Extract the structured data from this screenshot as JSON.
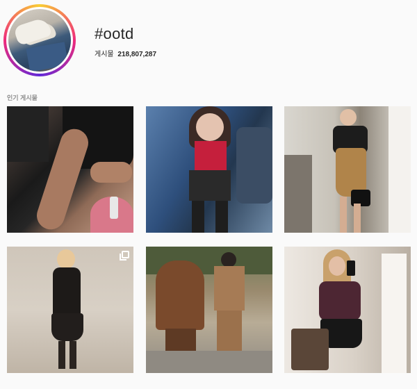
{
  "header": {
    "hashtag": "#ootd",
    "posts_label": "게시물",
    "posts_count": "218,807,287"
  },
  "top_posts": {
    "section_label": "인기 게시물",
    "posts": [
      {
        "kind": "single"
      },
      {
        "kind": "single"
      },
      {
        "kind": "single"
      },
      {
        "kind": "multiple"
      },
      {
        "kind": "single"
      },
      {
        "kind": "single"
      }
    ]
  },
  "colors": {
    "background": "#fafafa",
    "text_primary": "#262626",
    "text_secondary": "#8e8e8e",
    "story_ring": [
      "#f9ce34",
      "#ee2a7b",
      "#6228d7"
    ]
  },
  "icons": {
    "carousel_indicator": "multiple-posts-icon"
  }
}
